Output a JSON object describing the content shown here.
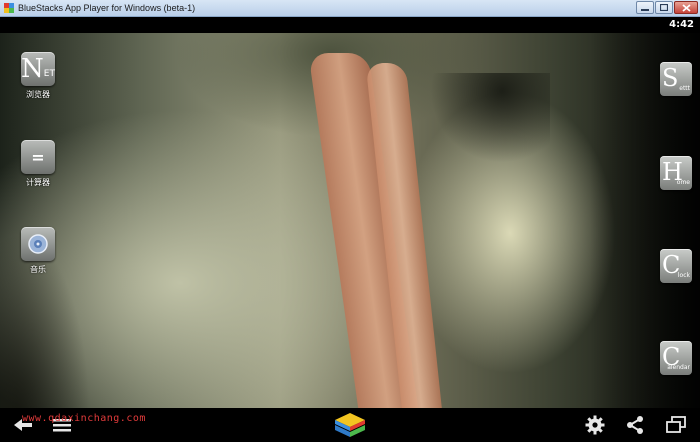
{
  "window": {
    "title": "BlueStacks App Player for Windows (beta-1)",
    "controls": [
      "minimize-icon",
      "maximize-icon",
      "close-icon"
    ]
  },
  "statusbar": {
    "time": "4:42"
  },
  "desktop_apps": [
    {
      "label": "浏览器",
      "icon": "net-browser-icon",
      "glyph": "N",
      "glyph_small": "ET"
    },
    {
      "label": "计算器",
      "icon": "calculator-icon",
      "glyph": "="
    },
    {
      "label": "音乐",
      "icon": "music-icon"
    }
  ],
  "widgets": [
    {
      "big": "S",
      "small": "ettt"
    },
    {
      "big": "H",
      "small": "ome"
    },
    {
      "big": "C",
      "small": "lock"
    },
    {
      "big": "C",
      "small": "alendar"
    }
  ],
  "navbar": {
    "watermark": "www.qdaxinchang.com",
    "left_buttons": [
      "back-icon",
      "menu-icon"
    ],
    "center_icon": "bluestacks-logo-icon",
    "right_buttons": [
      "settings-gear-icon",
      "share-icon",
      "window-toggle-icon"
    ]
  },
  "colors": {
    "titlebar": "#c8dbf0",
    "watermark": "#e23b3b",
    "close_button": "#c4433a"
  }
}
